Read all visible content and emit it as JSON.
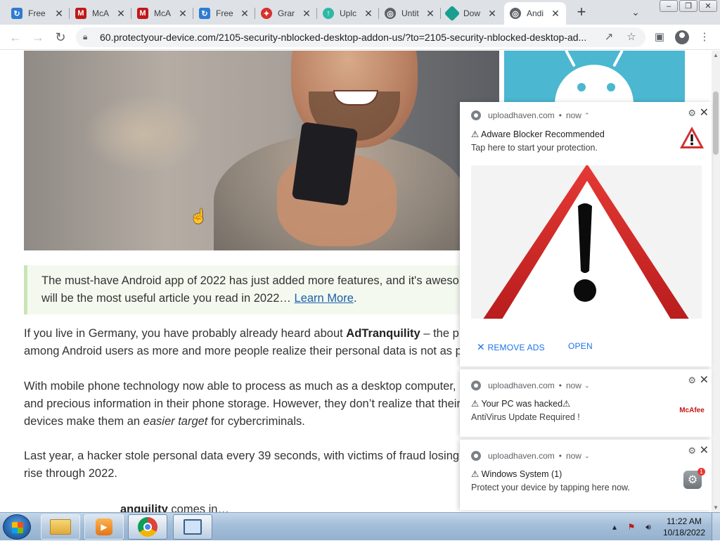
{
  "browser": {
    "tabs": [
      {
        "label": "Free",
        "icon": "free-download-icon",
        "color": "#2f7bd1",
        "active": false
      },
      {
        "label": "McA",
        "icon": "mcafee-icon",
        "color": "#c01818",
        "active": false
      },
      {
        "label": "McA",
        "icon": "mcafee-icon",
        "color": "#c01818",
        "active": false
      },
      {
        "label": "Free",
        "icon": "free-download-icon",
        "color": "#2f7bd1",
        "active": false
      },
      {
        "label": "Grar",
        "icon": "gift-icon",
        "color": "#d5312b",
        "active": false
      },
      {
        "label": "Uplc",
        "icon": "upload-icon",
        "color": "#2eb9a4",
        "active": false
      },
      {
        "label": "Untit",
        "icon": "globe-icon",
        "color": "#5f6368",
        "active": false
      },
      {
        "label": "Dow",
        "icon": "download-icon",
        "color": "#1a9e8f",
        "active": false
      },
      {
        "label": "Andi",
        "icon": "globe-icon",
        "color": "#5f6368",
        "active": true
      }
    ],
    "url": "60.protectyour-device.com/2105-security-nblocked-desktop-addon-us/?to=2105-security-nblocked-desktop-ad..."
  },
  "article": {
    "callout_text": "The must-have Android app of 2022 has just added more features, and it's aweso",
    "callout_text_2": "will be the most useful article you read in 2022… ",
    "callout_link": "Learn More",
    "callout_link_tail": ".",
    "p1_a": "If you live in Germany, you have probably already heard about ",
    "p1_bold": "AdTranquility",
    "p1_b": " – the p",
    "p1_line2": "among Android users as more and more people realize their personal data is not as p",
    "p2_line1": "With mobile phone technology now able to process as much as a desktop computer,",
    "p2_line2": "and precious information in their phone storage. However, they don’t realize that their",
    "p2_line3a": "devices make them an ",
    "p2_italic": "easier target",
    "p2_line3b": " for cybercriminals.",
    "p3_line1": "Last year, a hacker stole personal data every 39 seconds, with victims of fraud losing",
    "p3_line2": "rise through 2022.",
    "p4_bold": "anquility",
    "p4_rest": " comes in…"
  },
  "notifications": [
    {
      "source": "uploadhaven.com",
      "time": "now",
      "title": "⚠ Adware Blocker Recommended",
      "body": "Tap here to start your protection.",
      "action_remove": "REMOVE ADS",
      "action_open": "OPEN",
      "icon": "warning-triangle-icon"
    },
    {
      "source": "uploadhaven.com",
      "time": "now",
      "title": "⚠ Your PC was hacked⚠",
      "body": "AntiVirus Update Required !",
      "icon": "mcafee-logo-icon",
      "logo_text": "McAfee"
    },
    {
      "source": "uploadhaven.com",
      "time": "now",
      "title": "⚠ Windows System (1)",
      "body": "Protect your device by tapping here now.",
      "icon": "settings-badge-icon",
      "badge": "1"
    }
  ],
  "taskbar": {
    "time": "11:22 AM",
    "date": "10/18/2022",
    "apps": [
      "file-explorer-icon",
      "media-player-icon",
      "chrome-icon",
      "network-app-icon"
    ]
  },
  "colors": {
    "accent_blue": "#1a73e8",
    "warning_red": "#d32f2f",
    "callout_border": "#c9e5b4"
  }
}
